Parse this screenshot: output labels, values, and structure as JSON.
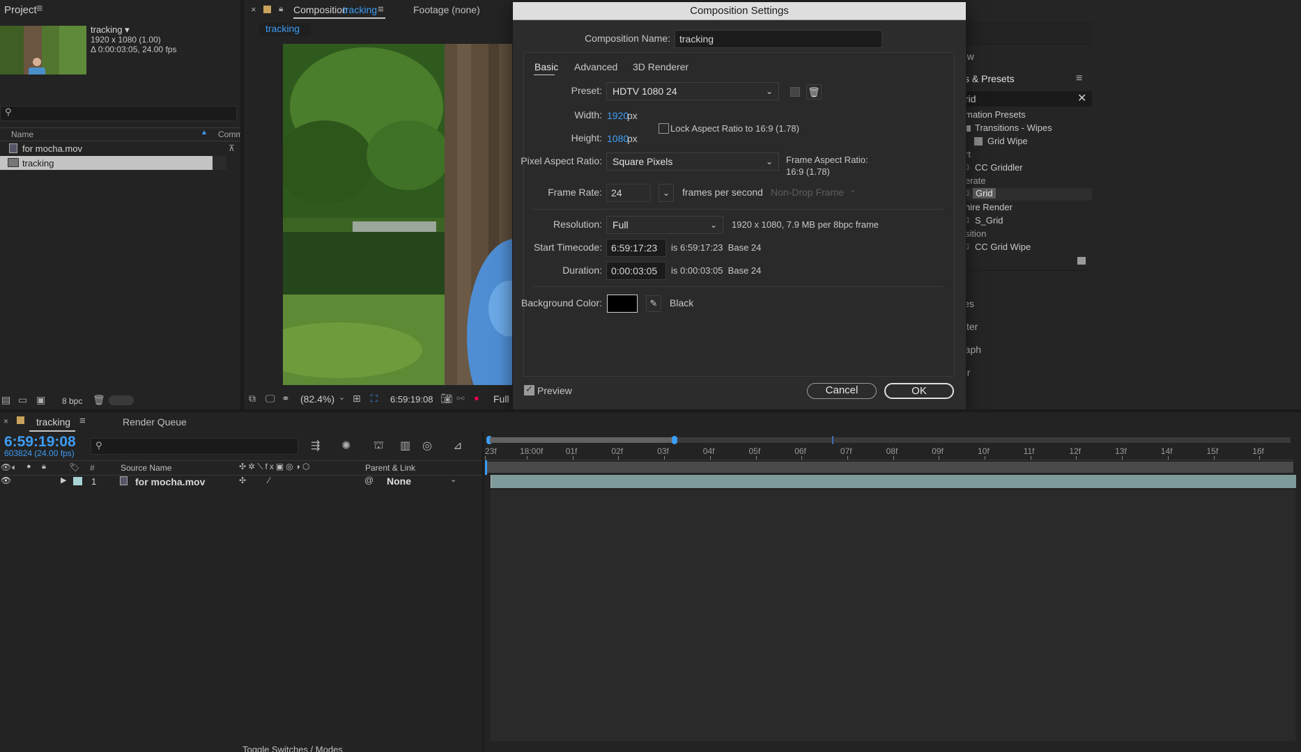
{
  "project": {
    "title": "Project",
    "comp_name": "tracking ▾",
    "comp_size": "1920 x 1080 (1.00)",
    "comp_duration": "Δ 0:00:03:05, 24.00 fps",
    "col_name": "Name",
    "col_comment": "Comm",
    "items": [
      {
        "name": "for mocha.mov"
      },
      {
        "name": "tracking"
      }
    ],
    "bpc": "8 bpc"
  },
  "viewer": {
    "tab_prefix": "Composition",
    "tab_comp": "tracking",
    "footage_tab": "Footage (none)",
    "comp_chip": "tracking",
    "zoom": "(82.4%)",
    "timecode": "6:59:19:08",
    "resolution": "Full"
  },
  "effects": {
    "partial_view": "ew",
    "title": "s & Presets",
    "search_value": "rid",
    "items": [
      "mation Presets",
      "Transitions - Wipes",
      "Grid Wipe",
      "rt",
      "CC Griddler",
      "erate",
      "Grid",
      "hire Render",
      "S_Grid",
      "sition",
      "CC Grid Wipe"
    ],
    "lower_items": [
      "ies",
      "cter",
      "raph",
      "er"
    ]
  },
  "dialog": {
    "title": "Composition Settings",
    "comp_name_label": "Composition Name:",
    "comp_name_value": "tracking",
    "tabs": [
      "Basic",
      "Advanced",
      "3D Renderer"
    ],
    "preset_label": "Preset:",
    "preset_value": "HDTV 1080 24",
    "width_label": "Width:",
    "width_value": "1920",
    "height_label": "Height:",
    "height_value": "1080",
    "px": "px",
    "lock_aspect": "Lock Aspect Ratio to 16:9 (1.78)",
    "par_label": "Pixel Aspect Ratio:",
    "par_value": "Square Pixels",
    "far_label": "Frame Aspect Ratio:",
    "far_value": "16:9 (1.78)",
    "fps_label": "Frame Rate:",
    "fps_value": "24",
    "fps_unit": "frames per second",
    "drop_frame": "Non-Drop Frame",
    "res_label": "Resolution:",
    "res_value": "Full",
    "res_info": "1920 x 1080, 7.9 MB per 8bpc frame",
    "start_label": "Start Timecode:",
    "start_value": "6:59:17:23",
    "start_info": "is 6:59:17:23  Base 24",
    "dur_label": "Duration:",
    "dur_value": "0:00:03:05",
    "dur_info": "is 0:00:03:05  Base 24",
    "bg_label": "Background Color:",
    "bg_name": "Black",
    "bg_color": "#000000",
    "preview": "Preview",
    "cancel": "Cancel",
    "ok": "OK"
  },
  "timeline": {
    "tab": "tracking",
    "render_queue": "Render Queue",
    "timecode": "6:59:19:08",
    "frames": "603824 (24.00 fps)",
    "col_hash": "#",
    "col_source": "Source Name",
    "col_parent": "Parent & Link",
    "layer_num": "1",
    "layer_name": "for mocha.mov",
    "parent_value": "None",
    "ruler": [
      "23f",
      "18:00f",
      "01f",
      "02f",
      "03f",
      "04f",
      "05f",
      "06f",
      "07f",
      "08f",
      "09f",
      "10f",
      "11f",
      "12f",
      "13f",
      "14f",
      "15f",
      "16f"
    ],
    "footer": "Toggle Switches / Modes"
  },
  "colors": {
    "accent_blue": "#3d9df5",
    "panel_bg": "#232323",
    "dialog_bg": "#2c2c2c",
    "layer_bar": "#7f9a9a"
  }
}
